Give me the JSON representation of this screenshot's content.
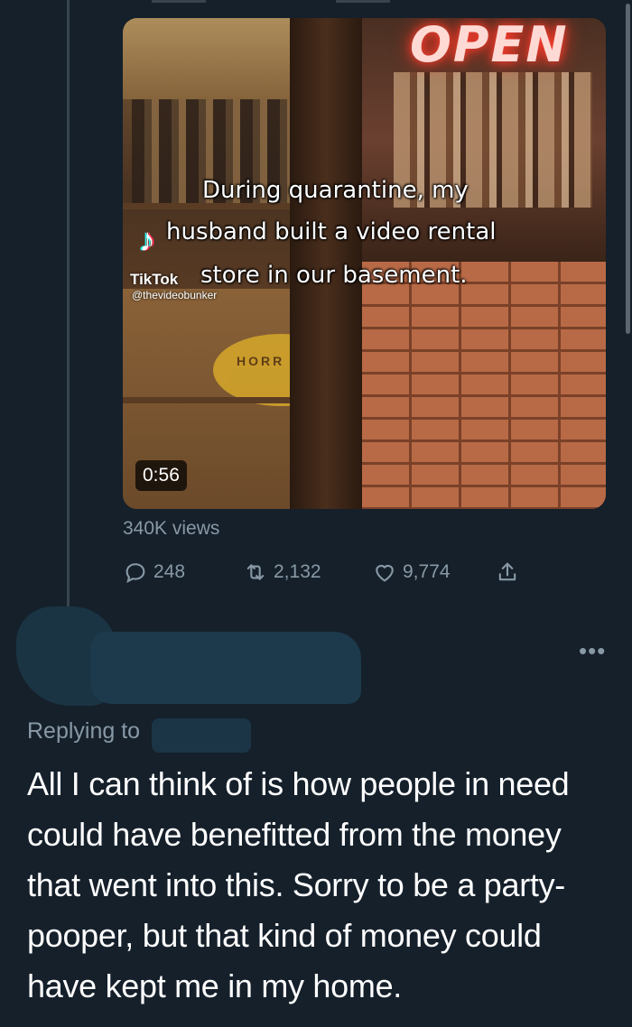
{
  "colors": {
    "background": "#15202b",
    "secondary_text": "#8899a6",
    "primary_text": "#ffffff",
    "thread_line": "#38444d"
  },
  "tweet": {
    "video": {
      "sign_text": "OPEN",
      "overlay_lines": [
        "During quarantine, my",
        "husband built a video rental",
        "store in our basement."
      ],
      "watermark_name": "TikTok",
      "watermark_handle": "@thevideobunker",
      "floor_sticker_text": "HORR",
      "duration": "0:56"
    },
    "views": "340K views",
    "actions": {
      "reply_icon": "reply-icon",
      "reply_count": "248",
      "retweet_icon": "retweet-icon",
      "retweet_count": "2,132",
      "like_icon": "heart-icon",
      "like_count": "9,774",
      "share_icon": "share-icon"
    }
  },
  "reply": {
    "more_label": "•••",
    "replying_to_label": "Replying to",
    "text": "All I can think of is how people in need could have benefitted from the money that went into this. Sorry to be a party-pooper, but that kind of money could have kept me in my home."
  }
}
